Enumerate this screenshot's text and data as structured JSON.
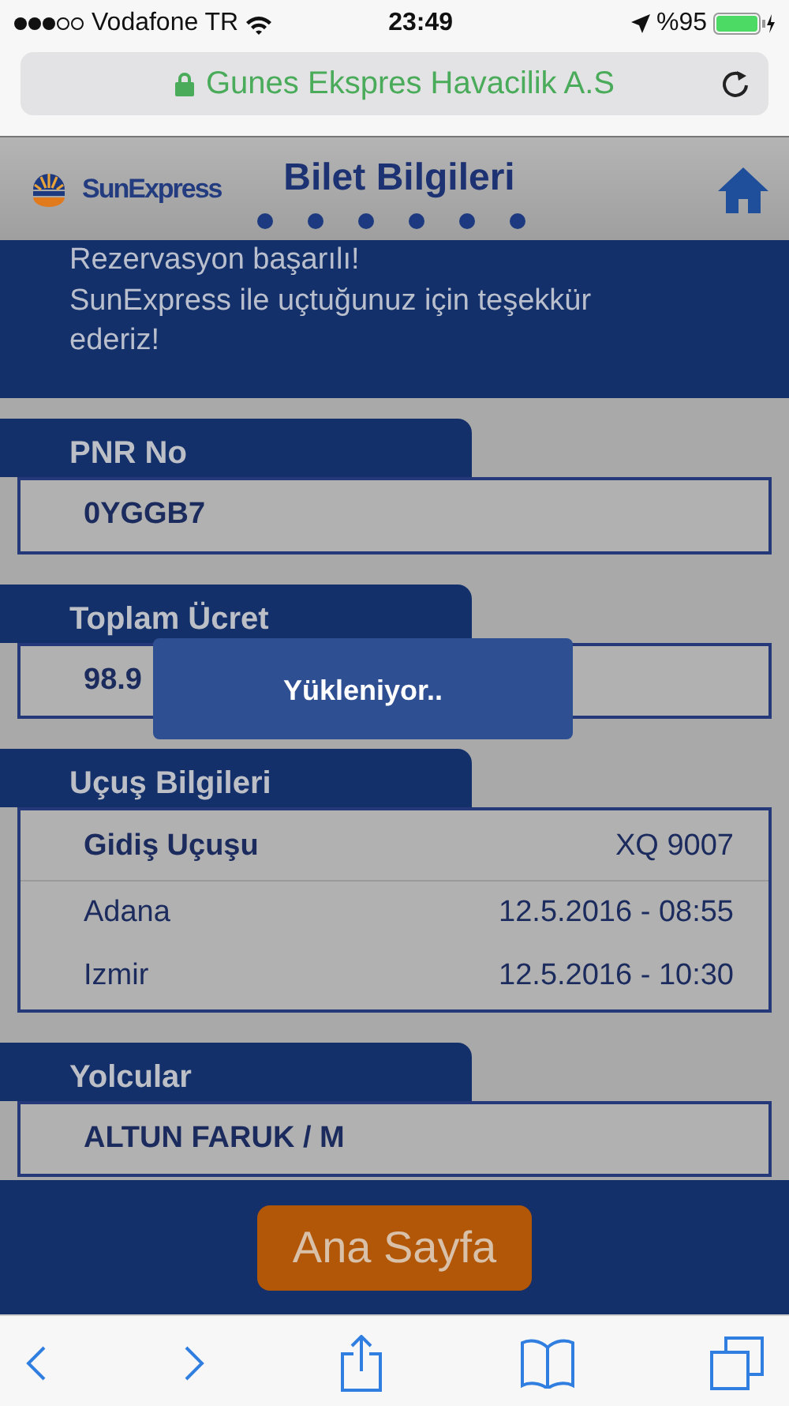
{
  "status_bar": {
    "carrier": "Vodafone TR",
    "time": "23:49",
    "battery": "%95"
  },
  "address_bar": {
    "site": "Gunes Ekspres Havacilik A.S"
  },
  "header": {
    "brand": "SunExpress",
    "title": "Bilet Bilgileri"
  },
  "message": {
    "lines": [
      "Rezervasyon başarılı!",
      "SunExpress ile uçtuğunuz için teşekkür ederiz!"
    ]
  },
  "sections": [
    {
      "kind": "value",
      "title": "PNR No",
      "value": "0YGGB7"
    },
    {
      "kind": "value",
      "title": "Toplam Ücret",
      "value": "98.9"
    },
    {
      "kind": "flight",
      "title": "Uçuş Bilgileri",
      "flight": {
        "label": "Gidiş Uçuşu",
        "number": "XQ 9007",
        "stops": [
          {
            "city": "Adana",
            "time": "12.5.2016 - 08:55"
          },
          {
            "city": "Izmir",
            "time": "12.5.2016 - 10:30"
          }
        ]
      }
    },
    {
      "kind": "value",
      "title": "Yolcular",
      "value": "ALTUN FARUK / M"
    }
  ],
  "loading": {
    "text": "Yükleniyor.."
  },
  "home_button": "Ana Sayfa"
}
